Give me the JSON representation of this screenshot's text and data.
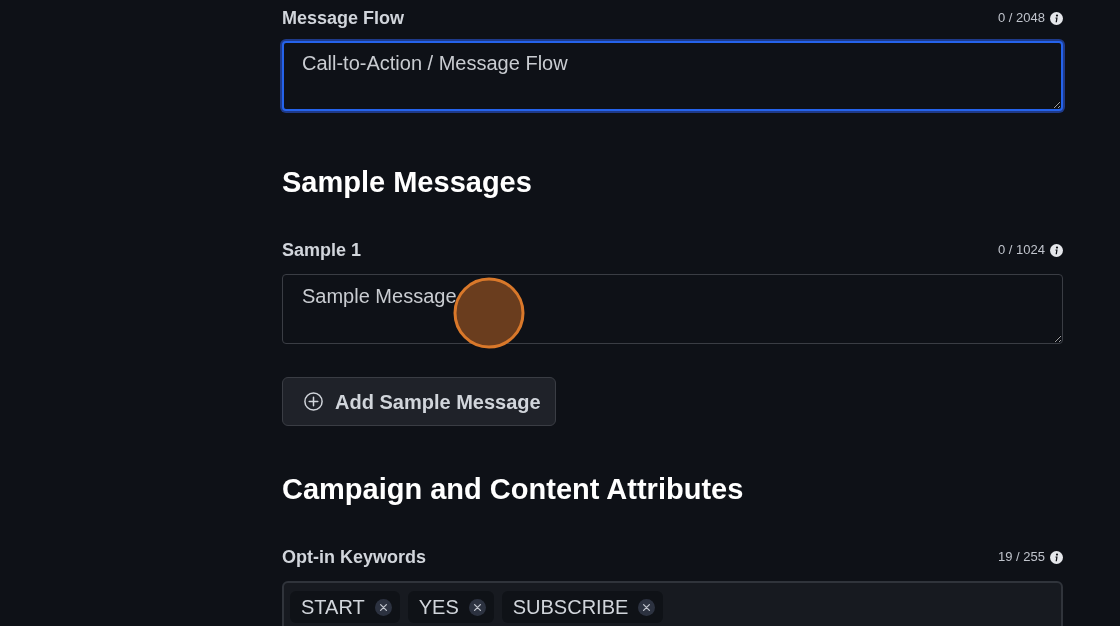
{
  "message_flow": {
    "label": "Message Flow",
    "counter": "0 / 2048",
    "placeholder": "Call-to-Action / Message Flow",
    "focused": true
  },
  "sample_messages": {
    "heading": "Sample Messages",
    "samples": [
      {
        "label": "Sample 1",
        "counter": "0 / 1024",
        "placeholder": "Sample Message",
        "focused": false
      }
    ],
    "add_button": "Add Sample Message"
  },
  "campaign_attributes": {
    "heading": "Campaign and Content Attributes",
    "opt_in_keywords": {
      "label": "Opt-in Keywords",
      "counter": "19 / 255",
      "tags": [
        "START",
        "YES",
        "SUBSCRIBE"
      ]
    }
  }
}
